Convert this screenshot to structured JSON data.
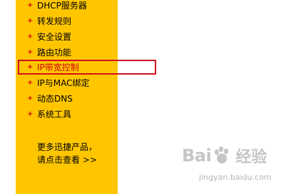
{
  "menu": {
    "items": [
      {
        "label": "DHCP服务器",
        "active": false
      },
      {
        "label": "转发规则",
        "active": false
      },
      {
        "label": "安全设置",
        "active": false
      },
      {
        "label": "路由功能",
        "active": false
      },
      {
        "label": "IP带宽控制",
        "active": true
      },
      {
        "label": "IP与MAC绑定",
        "active": false
      },
      {
        "label": "动态DNS",
        "active": false
      },
      {
        "label": "系统工具",
        "active": false
      }
    ],
    "bullet": "+"
  },
  "promo": {
    "line1": "更多迅捷产品，",
    "line2": "请点击查看 >>"
  },
  "watermark": {
    "brand": "Bai",
    "brand_tail": "经验",
    "url": "jingyan.baidu.com"
  },
  "colors": {
    "sidebar": "#ffc600",
    "bullet": "#d0000a",
    "highlight_border": "#d0101c"
  }
}
